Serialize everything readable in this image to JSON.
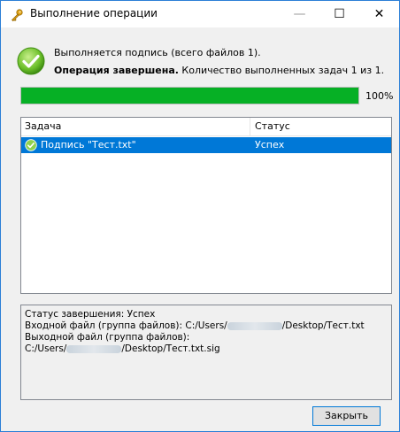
{
  "window": {
    "title": "Выполнение операции",
    "controls": {
      "minimize": "—",
      "maximize": "☐",
      "close": "✕"
    }
  },
  "summary": {
    "line1": "Выполняется подпись (всего файлов 1).",
    "line2_bold": "Операция завершена.",
    "line2_rest": " Количество выполненных задач 1 из 1."
  },
  "progress": {
    "value": 1.0,
    "label": "100%",
    "color": "#06b025"
  },
  "table": {
    "columns": [
      "Задача",
      "Статус"
    ],
    "rows": [
      {
        "task": "Подпись \"Тест.txt\"",
        "status": "Успех",
        "selected": true,
        "icon": "check-icon"
      }
    ]
  },
  "details": {
    "status_line": "Статус завершения: Успех",
    "input_prefix": "Входной файл (группа файлов): C:/Users/",
    "input_suffix": "/Desktop/Тест.txt",
    "output_label": "Выходной файл (группа файлов):",
    "output_prefix": "C:/Users/",
    "output_suffix": "/Desktop/Тест.txt.sig"
  },
  "buttons": {
    "close": "Закрыть"
  },
  "colors": {
    "selection": "#0078d7",
    "accent_border": "#2b7fd6",
    "success": "#06b025"
  }
}
